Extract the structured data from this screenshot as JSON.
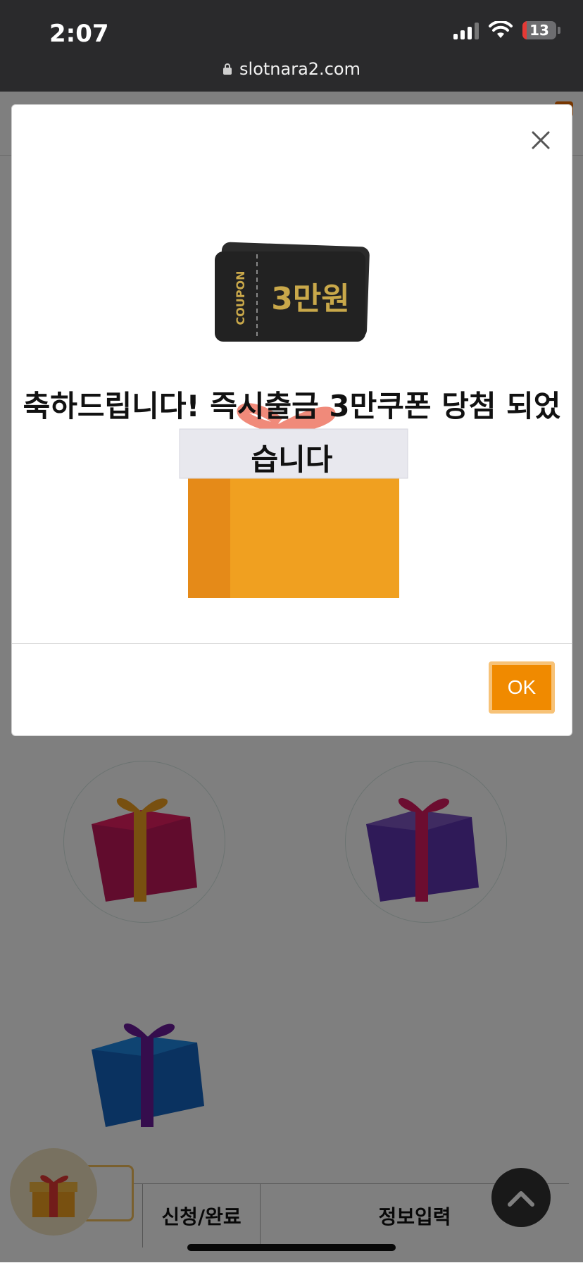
{
  "status_bar": {
    "time": "2:07",
    "battery": "13",
    "url": "slotnara2.com"
  },
  "modal": {
    "coupon_label": "COUPON",
    "coupon_value": "3만원",
    "title": "축하드립니다! 즉시출금 3만쿠폰 당첨 되었습니다",
    "ok_label": "OK"
  },
  "background_page": {
    "table_headers": [
      "신청/완료",
      "정보입력"
    ]
  },
  "colors": {
    "accent": "#f08a00",
    "status_bar": "#2a2a2c"
  }
}
